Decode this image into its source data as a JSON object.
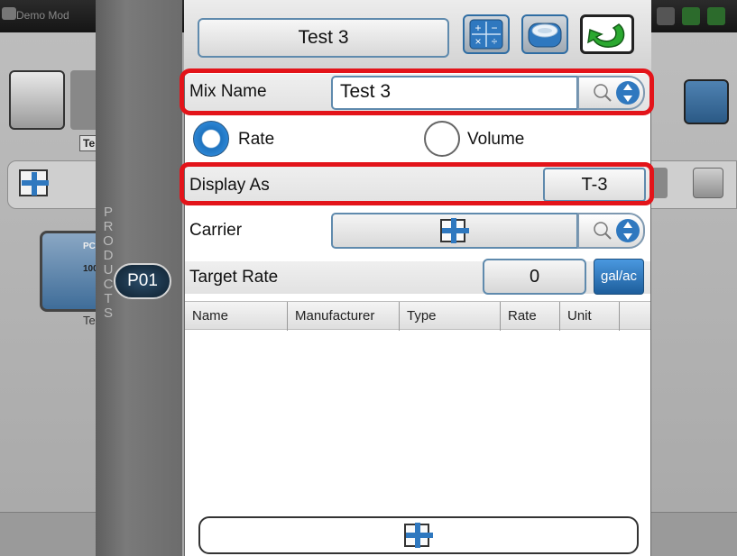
{
  "background": {
    "demo_label": "Demo Mod",
    "left_machine_label": "Te",
    "left_tile_line1": "PC",
    "left_tile_line2": "100",
    "left_tile_label": "Te"
  },
  "products_rail": {
    "label": "PRODUCTS",
    "active_product": "P01"
  },
  "header": {
    "title": "Test 3",
    "icons": [
      "calculator-icon",
      "database-icon",
      "back-arrow-icon"
    ]
  },
  "form": {
    "mix_name_label": "Mix Name",
    "mix_name_value": "Test 3",
    "rate_option": "Rate",
    "volume_option": "Volume",
    "selected_option": "Rate",
    "display_as_label": "Display As",
    "display_as_value": "T-3",
    "carrier_label": "Carrier",
    "target_rate_label": "Target Rate",
    "target_rate_value": "0",
    "target_rate_unit": "gal/ac"
  },
  "table": {
    "columns": [
      "Name",
      "Manufacturer",
      "Type",
      "Rate",
      "Unit"
    ],
    "rows": []
  },
  "colors": {
    "highlight": "#e3141a",
    "accent_blue": "#1e73bf",
    "field_border": "#5f8aad"
  }
}
